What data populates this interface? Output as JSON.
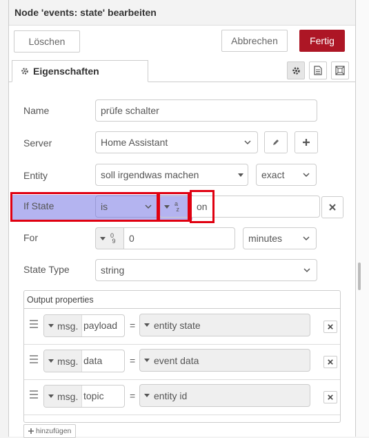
{
  "dialog": {
    "title": "Node 'events: state' bearbeiten",
    "delete_label": "Löschen",
    "cancel_label": "Abbrechen",
    "done_label": "Fertig"
  },
  "tabs": {
    "properties_label": "Eigenschaften"
  },
  "form": {
    "name": {
      "label": "Name",
      "value": "prüfe schalter"
    },
    "server": {
      "label": "Server",
      "value": "Home Assistant"
    },
    "entity": {
      "label": "Entity",
      "value": "soll irgendwas machen",
      "match": "exact"
    },
    "if_state": {
      "label": "If State",
      "operator": "is",
      "type_icon": "a-z",
      "value": "on"
    },
    "for": {
      "label": "For",
      "type_icon": "0-9",
      "value": "0",
      "unit": "minutes"
    },
    "state_type": {
      "label": "State Type",
      "value": "string"
    }
  },
  "output_properties": {
    "header": "Output properties",
    "rows": [
      {
        "prefix": "msg.",
        "property": "payload",
        "equals": "=",
        "value": "entity state"
      },
      {
        "prefix": "msg.",
        "property": "data",
        "equals": "=",
        "value": "event data"
      },
      {
        "prefix": "msg.",
        "property": "topic",
        "equals": "=",
        "value": "entity id"
      }
    ],
    "add_label": "hinzufügen"
  },
  "colors": {
    "primary_button": "#ad1625",
    "highlight": "#b4b4f0",
    "annotation_box": "#e00010"
  }
}
